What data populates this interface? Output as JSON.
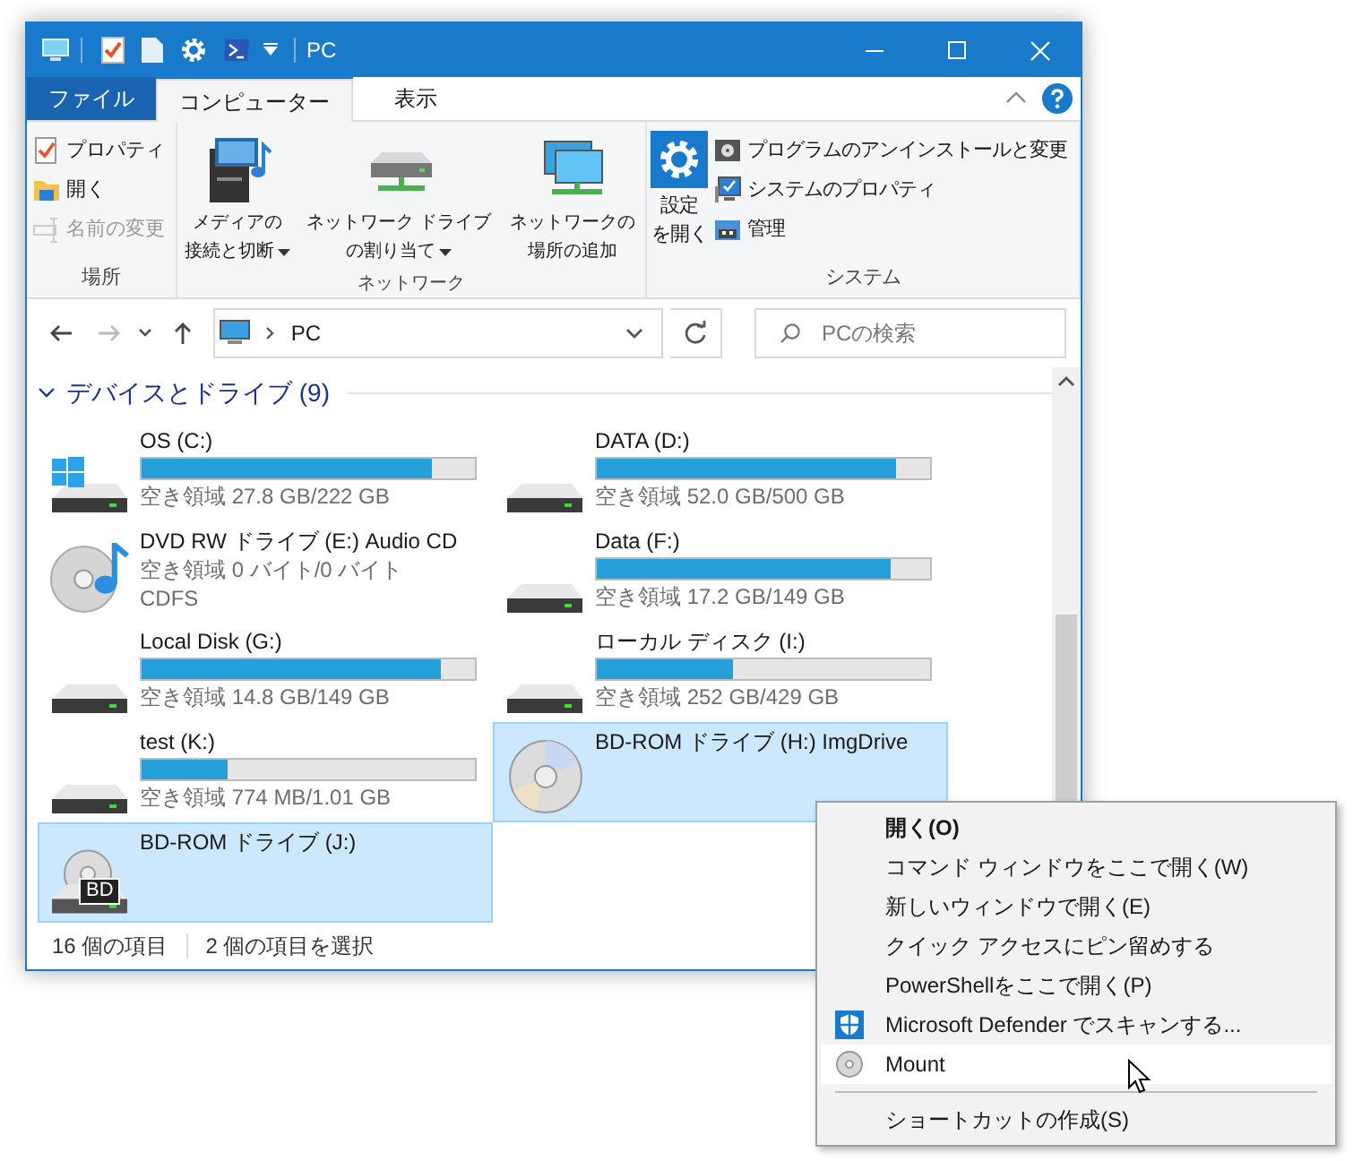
{
  "window": {
    "title": "PC"
  },
  "tabs": [
    {
      "label": "ファイル",
      "kind": "file",
      "selected": false
    },
    {
      "label": "コンピューター",
      "kind": "tab",
      "selected": true
    },
    {
      "label": "表示",
      "kind": "tab",
      "selected": false
    }
  ],
  "ribbon": {
    "groups": [
      {
        "label": "場所",
        "kind": "small",
        "items": [
          {
            "label": "プロパティ",
            "disabled": false
          },
          {
            "label": "開く",
            "disabled": false
          },
          {
            "label": "名前の変更",
            "disabled": true
          }
        ]
      },
      {
        "label": "ネットワーク",
        "kind": "large",
        "items": [
          {
            "lines": [
              "メディアの",
              "接続と切断"
            ],
            "dropdown": true
          },
          {
            "lines": [
              "ネットワーク ドライブ",
              "の割り当て"
            ],
            "dropdown": true
          },
          {
            "lines": [
              "ネットワークの",
              "場所の追加"
            ],
            "dropdown": false
          }
        ]
      },
      {
        "label": "システム",
        "kind": "mixed",
        "large": {
          "lines": [
            "設定",
            "を開く"
          ]
        },
        "items": [
          {
            "label": "プログラムのアンインストールと変更",
            "disabled": false
          },
          {
            "label": "システムのプロパティ",
            "disabled": false
          },
          {
            "label": "管理",
            "disabled": false
          }
        ]
      }
    ]
  },
  "address": {
    "path": "PC",
    "search_placeholder": "PCの検索"
  },
  "section": {
    "title": "デバイスとドライブ (9)",
    "expanded": true
  },
  "drives": [
    {
      "name": "OS (C:)",
      "kind": "windows",
      "level": 0.87,
      "free": "空き領域 27.8 GB/222 GB",
      "selected": false
    },
    {
      "name": "DATA (D:)",
      "kind": "hdd",
      "level": 0.9,
      "free": "空き領域 52.0 GB/500 GB",
      "selected": false
    },
    {
      "name": "DVD RW ドライブ (E:) Audio CD",
      "kind": "audio-cd",
      "free": "空き領域 0 バイト/0 バイト",
      "extra": "CDFS",
      "selected": false
    },
    {
      "name": "Data (F:)",
      "kind": "hdd",
      "level": 0.88,
      "free": "空き領域 17.2 GB/149 GB",
      "selected": false
    },
    {
      "name": "Local Disk (G:)",
      "kind": "hdd",
      "level": 0.9,
      "free": "空き領域 14.8 GB/149 GB",
      "selected": false
    },
    {
      "name": "ローカル ディスク (I:)",
      "kind": "hdd",
      "level": 0.41,
      "free": "空き領域 252 GB/429 GB",
      "selected": false
    },
    {
      "name": "test (K:)",
      "kind": "hdd",
      "level": 0.26,
      "free": "空き領域 774 MB/1.01 GB",
      "selected": false
    },
    {
      "name": "BD-ROM ドライブ (H:) ImgDrive",
      "kind": "disc",
      "selected": true
    },
    {
      "name": "BD-ROM ドライブ (J:)",
      "kind": "bd",
      "badge": "BD",
      "selected": true
    }
  ],
  "status_bar": {
    "count": "16 個の項目",
    "selection": "2 個の項目を選択"
  },
  "context_menu": [
    {
      "kind": "text",
      "text": "開く(O)",
      "default": true,
      "highlighted": false
    },
    {
      "kind": "text",
      "text": "コマンド ウィンドウをここで開く(W)",
      "default": false,
      "highlighted": false
    },
    {
      "kind": "text",
      "text": "新しいウィンドウで開く(E)",
      "default": false,
      "highlighted": false
    },
    {
      "kind": "text",
      "text": "クイック アクセスにピン留めする",
      "default": false,
      "highlighted": false
    },
    {
      "kind": "text",
      "text": "PowerShellをここで開く(P)",
      "default": false,
      "highlighted": false
    },
    {
      "kind": "shield",
      "text": "Microsoft Defender でスキャンする...",
      "default": false,
      "highlighted": false
    },
    {
      "kind": "disc",
      "text": "Mount",
      "default": false,
      "highlighted": true
    },
    {
      "kind": "separator"
    },
    {
      "kind": "text",
      "text": "ショートカットの作成(S)",
      "default": false,
      "highlighted": false
    }
  ]
}
